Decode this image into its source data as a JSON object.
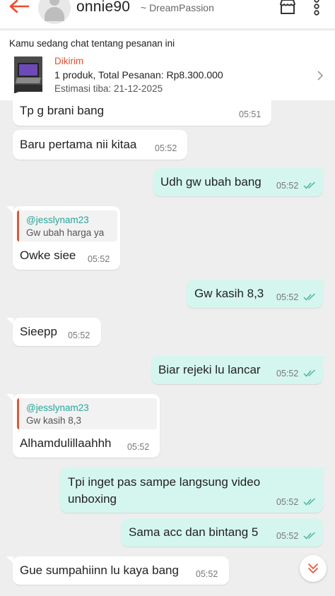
{
  "header": {
    "username": "onnie90",
    "shop_name": "~ DreamPassion",
    "icons": {
      "back": "arrow-left-icon",
      "shop": "shop-icon",
      "more": "more-vertical-icon"
    },
    "accent_color": "#ee4d2d"
  },
  "order": {
    "caption": "Kamu sedang chat tentang pesanan ini",
    "status": "Dikirim",
    "summary": "1 produk, Total Pesanan: Rp8.300.000",
    "eta": "Estimasi tiba: 21-12-2025"
  },
  "messages": [
    {
      "dir": "in",
      "text": "Tp g brani bang",
      "time": "05:51"
    },
    {
      "dir": "in",
      "text": "Baru pertama nii kitaa",
      "time": "05:52"
    },
    {
      "dir": "out",
      "text": "Udh gw ubah bang",
      "time": "05:52",
      "read": true
    },
    {
      "dir": "in",
      "reply_to": {
        "author": "@jesslynam23",
        "text": "Gw ubah harga ya"
      },
      "text": "Owke siee",
      "time": "05:52"
    },
    {
      "dir": "out",
      "text": "Gw kasih 8,3",
      "time": "05:52",
      "read": true
    },
    {
      "dir": "in",
      "text": "Sieepp",
      "time": "05:52"
    },
    {
      "dir": "out",
      "text": "Biar rejeki lu lancar",
      "time": "05:52",
      "read": true
    },
    {
      "dir": "in",
      "reply_to": {
        "author": "@jesslynam23",
        "text": "Gw kasih 8,3"
      },
      "text": "Alhamdulillaahhh",
      "time": "05:52"
    },
    {
      "dir": "out",
      "text_lines": [
        "Tpi inget pas sampe langsung video",
        "unboxing"
      ],
      "time": "05:52",
      "read": true
    },
    {
      "dir": "out",
      "text": "Sama acc dan bintang 5",
      "time": "05:52",
      "read": true
    },
    {
      "dir": "in",
      "text": "Gue sumpahiinn lu kaya bang",
      "time": "05:52"
    }
  ],
  "colors": {
    "outgoing_bubble": "#d5f6ee",
    "incoming_bubble": "#ffffff",
    "read_ticks": "#4fb3a4",
    "quote_bar": "#d85a3a"
  }
}
